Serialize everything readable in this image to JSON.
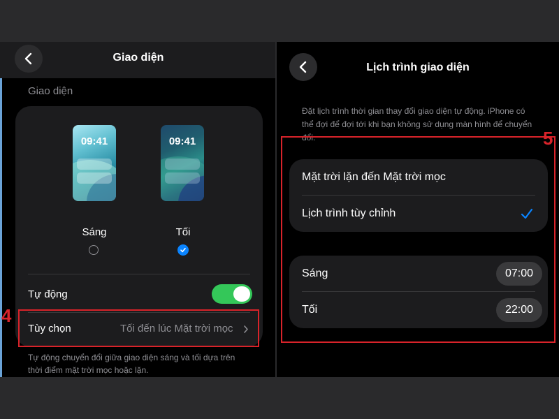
{
  "left": {
    "title": "Giao diện",
    "section_label": "Giao diện",
    "previews": [
      {
        "time": "09:41",
        "label": "Sáng",
        "selected": false
      },
      {
        "time": "09:41",
        "label": "Tối",
        "selected": true
      }
    ],
    "auto_label": "Tự động",
    "auto_enabled": true,
    "options_label": "Tùy chọn",
    "options_value": "Tối đến lúc Mặt trời mọc",
    "footer_note": "Tự động chuyển đổi giữa giao diện sáng và tối dựa trên thời điểm mặt trời mọc hoặc lặn.",
    "step_number": "4"
  },
  "right": {
    "title": "Lịch trình giao diện",
    "description": "Đặt lịch trình thời gian thay đổi giao diện tự động. iPhone có thể đợi để đợi tới khi bạn không sử dụng màn hình để chuyển đổi.",
    "schedule_options": [
      {
        "label": "Mặt trời lặn đến Mặt trời mọc",
        "checked": false
      },
      {
        "label": "Lịch trình tùy chỉnh",
        "checked": true
      }
    ],
    "times": [
      {
        "label": "Sáng",
        "value": "07:00"
      },
      {
        "label": "Tối",
        "value": "22:00"
      }
    ],
    "step_number": "5"
  },
  "icons": {
    "back": "chevron-left-icon",
    "chevron": "chevron-right-icon",
    "check": "checkmark-icon"
  },
  "colors": {
    "accent_blue": "#0a84ff",
    "toggle_green": "#34c759",
    "annotation_red": "#d8232a"
  }
}
